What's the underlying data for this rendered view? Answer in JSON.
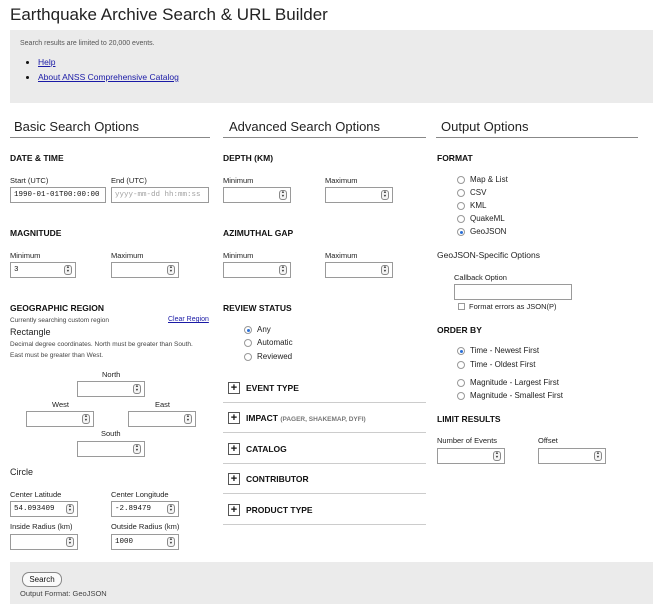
{
  "page": {
    "title": "Earthquake Archive Search & URL Builder"
  },
  "info": {
    "note": "Search results are limited to 20,000 events.",
    "links": [
      "Help",
      "About ANSS Comprehensive Catalog"
    ]
  },
  "basic": {
    "title": "Basic Search Options",
    "datetime": {
      "heading": "DATE & TIME",
      "start_label": "Start (UTC)",
      "start_value": "1990-01-01T00:00:00",
      "end_label": "End (UTC)",
      "end_placeholder": "yyyy-mm-dd hh:mm:ss"
    },
    "magnitude": {
      "heading": "MAGNITUDE",
      "min_label": "Minimum",
      "min_value": "3",
      "max_label": "Maximum",
      "max_value": ""
    },
    "region": {
      "heading": "GEOGRAPHIC REGION",
      "status": "Currently searching custom region",
      "clear_link": "Clear Region",
      "rect_title": "Rectangle",
      "rect_help_1": "Decimal degree coordinates. North must be greater than South.",
      "rect_help_2": "East must be greater than West.",
      "north": "North",
      "west": "West",
      "east": "East",
      "south": "South",
      "circle_title": "Circle",
      "center_lat_label": "Center Latitude",
      "center_lat_value": "54.093409",
      "center_lon_label": "Center Longitude",
      "center_lon_value": "-2.89479",
      "inner_label": "Inside Radius (km)",
      "inner_value": "",
      "outer_label": "Outside Radius (km)",
      "outer_value": "1000"
    }
  },
  "advanced": {
    "title": "Advanced Search Options",
    "depth": {
      "heading": "DEPTH (KM)",
      "min_label": "Minimum",
      "max_label": "Maximum"
    },
    "azgap": {
      "heading": "AZIMUTHAL GAP",
      "min_label": "Minimum",
      "max_label": "Maximum"
    },
    "review": {
      "heading": "REVIEW STATUS",
      "options": [
        "Any",
        "Automatic",
        "Reviewed"
      ],
      "selected": 0
    },
    "expanders": [
      {
        "icon": "+",
        "label": "EVENT TYPE",
        "sub": ""
      },
      {
        "icon": "+",
        "label": "IMPACT",
        "sub": "(PAGER, SHAKEMAP, DYFI)"
      },
      {
        "icon": "+",
        "label": "CATALOG",
        "sub": ""
      },
      {
        "icon": "+",
        "label": "CONTRIBUTOR",
        "sub": ""
      },
      {
        "icon": "+",
        "label": "PRODUCT TYPE",
        "sub": ""
      }
    ]
  },
  "output": {
    "title": "Output Options",
    "format": {
      "heading": "FORMAT",
      "options": [
        "Map & List",
        "CSV",
        "KML",
        "QuakeML",
        "GeoJSON"
      ],
      "selected": 4
    },
    "geojson": {
      "heading": "GeoJSON-Specific Options",
      "callback_label": "Callback Option",
      "callback_value": "",
      "errors_label": "Format errors as JSON(P)"
    },
    "order": {
      "heading": "ORDER BY",
      "options": [
        "Time - Newest First",
        "Time - Oldest First",
        "Magnitude - Largest First",
        "Magnitude - Smallest First"
      ],
      "selected": 0
    },
    "limit": {
      "heading": "LIMIT RESULTS",
      "events_label": "Number of Events",
      "offset_label": "Offset"
    }
  },
  "footer": {
    "search_button": "Search",
    "output_format": "Output Format: GeoJSON"
  },
  "colors": {
    "link": "#1a1aa6",
    "panel_bg": "#ebebeb",
    "radio_selected": "#2a6fd6"
  }
}
